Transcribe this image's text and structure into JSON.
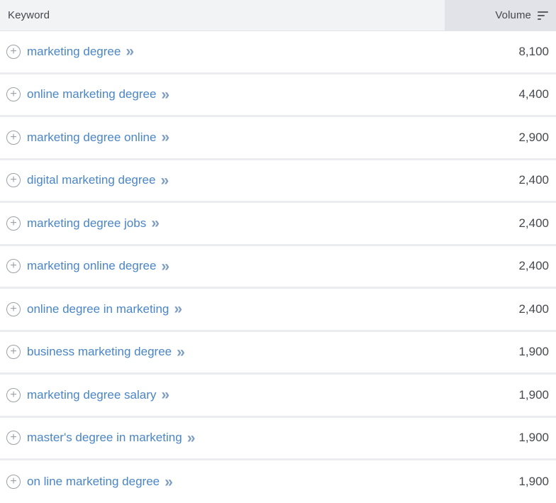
{
  "table": {
    "columns": [
      {
        "label": "Keyword"
      },
      {
        "label": "Volume"
      }
    ],
    "rows": [
      {
        "keyword": "marketing degree",
        "volume": "8,100"
      },
      {
        "keyword": "online marketing degree",
        "volume": "4,400"
      },
      {
        "keyword": "marketing degree online",
        "volume": "2,900"
      },
      {
        "keyword": "digital marketing degree",
        "volume": "2,400"
      },
      {
        "keyword": "marketing degree jobs",
        "volume": "2,400"
      },
      {
        "keyword": "marketing online degree",
        "volume": "2,400"
      },
      {
        "keyword": "online degree in marketing",
        "volume": "2,400"
      },
      {
        "keyword": "business marketing degree",
        "volume": "1,900"
      },
      {
        "keyword": "marketing degree salary",
        "volume": "1,900"
      },
      {
        "keyword": "master's degree in marketing",
        "volume": "1,900"
      },
      {
        "keyword": "on line marketing degree",
        "volume": "1,900"
      }
    ]
  },
  "icons": {
    "add_glyph": "+",
    "expand_glyph": "»",
    "sort_icon_name": "sort-descending"
  },
  "colors": {
    "link_blue": "#4a85c6",
    "chevron_blue": "#7f9dc2",
    "header_bg": "#f2f3f5",
    "volume_header_bg": "#e2e3e9",
    "row_separator": "#ebecef",
    "text_dark": "#46494e",
    "icon_gray": "#9ba1a8"
  }
}
